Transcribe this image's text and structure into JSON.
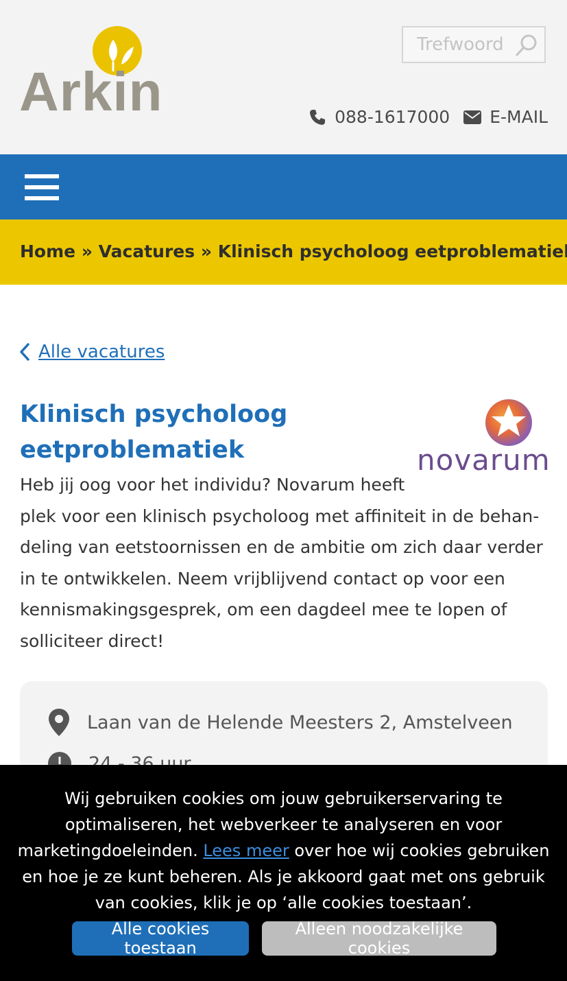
{
  "header": {
    "logo_text": "Arkin",
    "search_placeholder": "Trefwoord",
    "phone": "088-1617000",
    "email_label": "E-MAIL"
  },
  "breadcrumb": {
    "home": "Home",
    "separator": " » ",
    "vacatures": "Vacatures",
    "current": "Klinisch psycholoog eetproblematiek"
  },
  "main": {
    "back_link": "Alle vacatures",
    "title": "Klinisch psycholoog eetproblematiek",
    "partner_logo_text": "novarum",
    "intro": "Heb jij oog voor het individu? Novarum heeft plek voor een klinisch psycholoog met affiniteit in de behan­deling van eetstoornissen en de ambitie om zich daar verder in te ontwikkelen. Neem vrijblijvend contact op voor een kennismakingsgesprek, om een dagdeel mee te lopen of solliciteer direct!",
    "info": {
      "address": "Laan van de Helende Meesters 2, Amstelveen",
      "hours": "24 - 36 uur"
    }
  },
  "cookie_banner": {
    "text_before_link": "Wij gebruiken cookies om jouw gebruikerservaring te optimaliseren, het webverkeer te analyseren en voor marketingdoeleinden. ",
    "link_text": "Lees meer",
    "text_after_link": " over hoe wij cookies gebruiken en hoe je ze kunt beheren. Als je ak­koord gaat met ons gebruik van cookies, klik je op ‘alle cookies toestaan’.",
    "allow_all_label": "Alle cookies toestaan",
    "necessary_only_label": "Alleen noodzakelijke cookies"
  },
  "colors": {
    "brand_blue": "#1f6fb8",
    "brand_yellow": "#ecc700",
    "logo_grey": "#9a968a",
    "novarum_purple": "#6b4c8e"
  },
  "icons": [
    "leaf-logo-icon",
    "search-icon",
    "phone-icon",
    "envelope-icon",
    "hamburger-menu-icon",
    "chevron-left-icon",
    "novarum-star-icon",
    "location-pin-icon",
    "clock-icon"
  ]
}
